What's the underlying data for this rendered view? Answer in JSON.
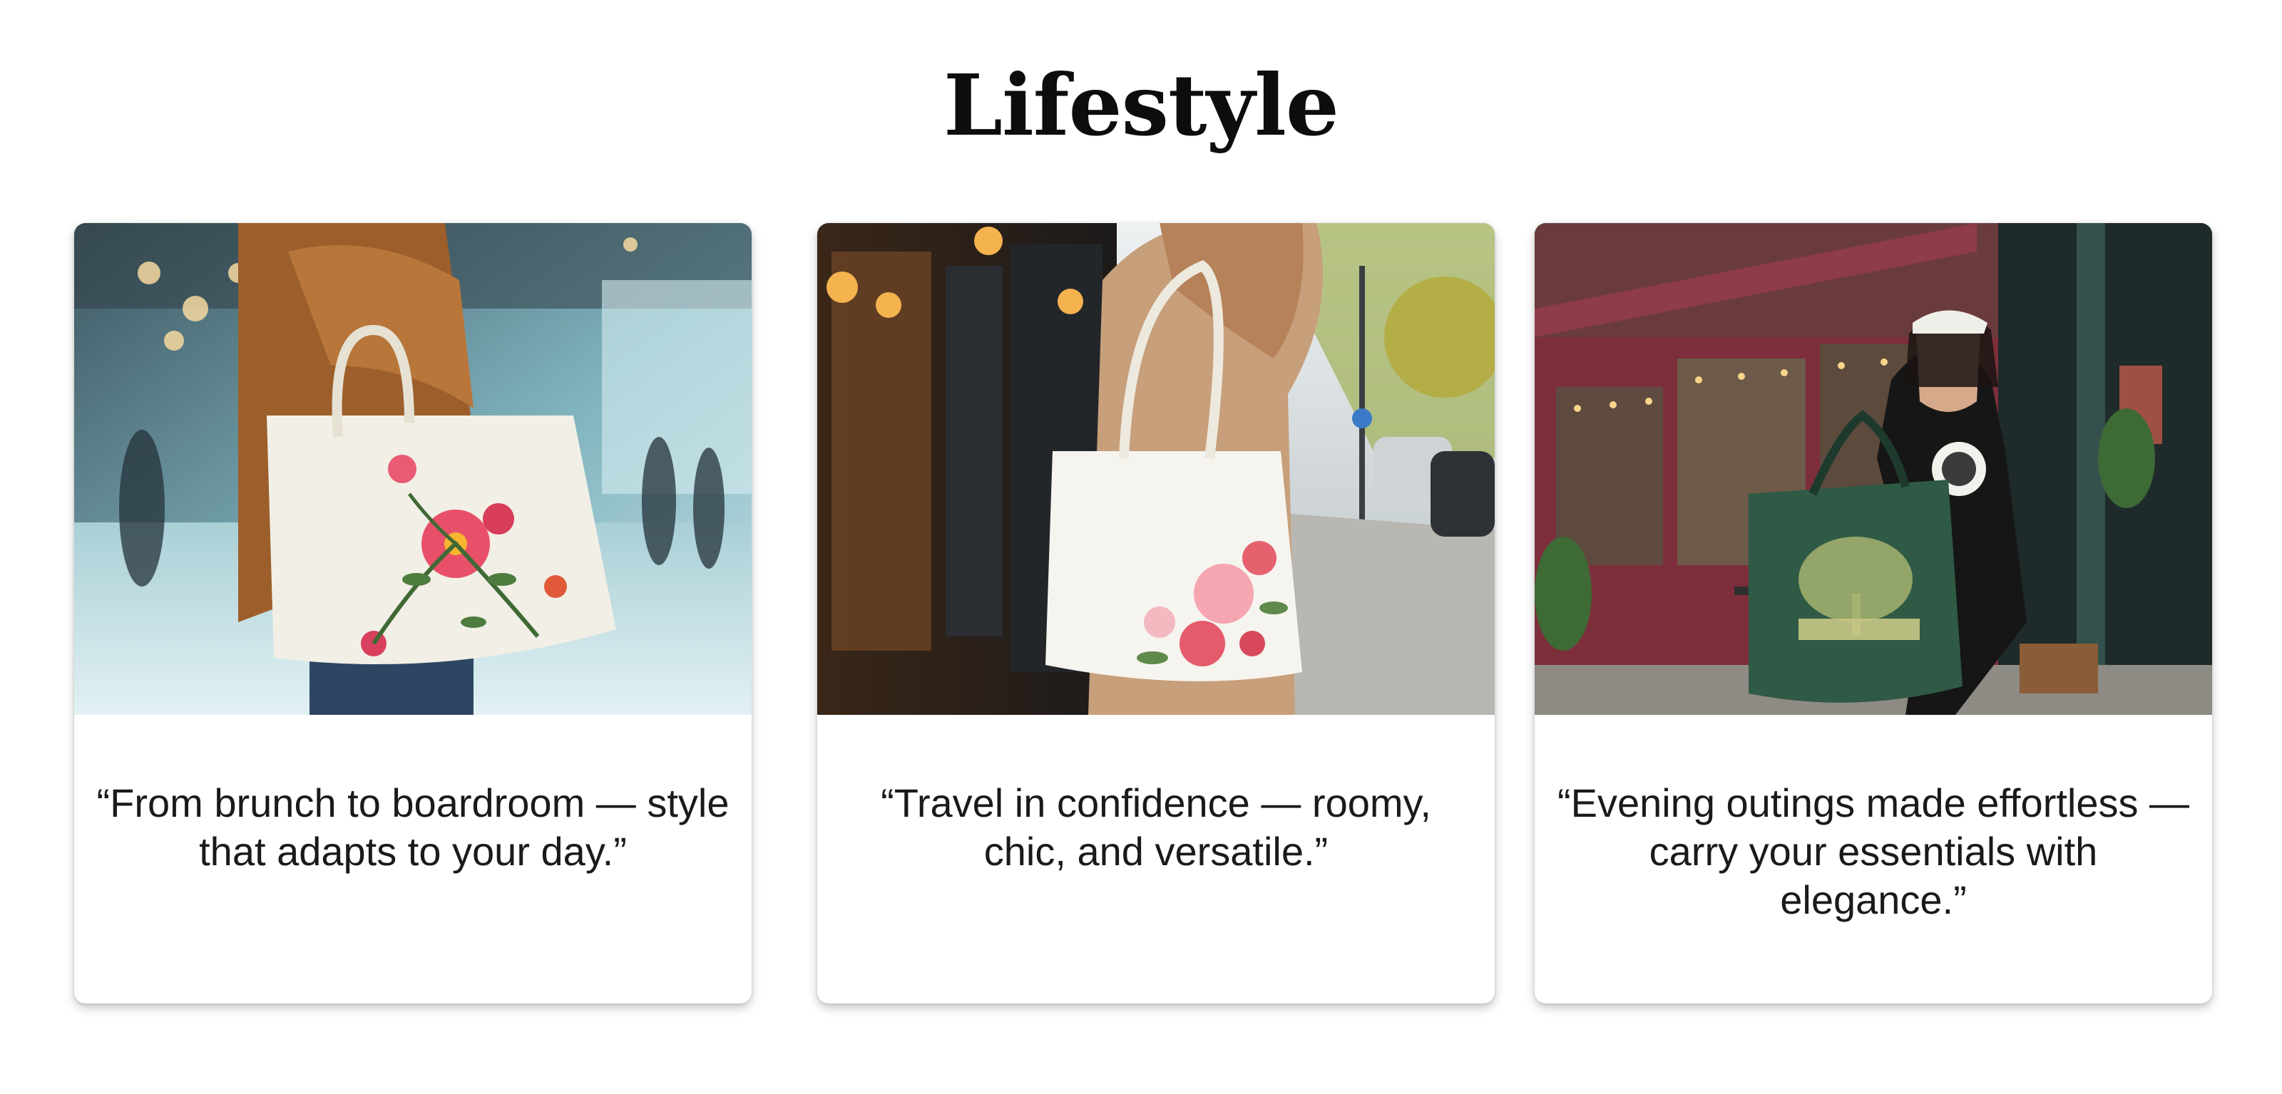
{
  "section": {
    "title": "Lifestyle"
  },
  "cards": [
    {
      "image_subject": "woman-in-camel-coat-with-floral-cream-tote-in-airport",
      "quote": "“From brunch to boardroom — style that adapts to your day.”"
    },
    {
      "image_subject": "woman-on-street-with-white-rose-tote",
      "quote": "“Travel in confidence — roomy, chic, and versatile.”"
    },
    {
      "image_subject": "woman-with-green-tree-print-tote-outside-cafe",
      "quote": "“Evening outings made effortless — carry your essentials with elegance.”"
    }
  ]
}
